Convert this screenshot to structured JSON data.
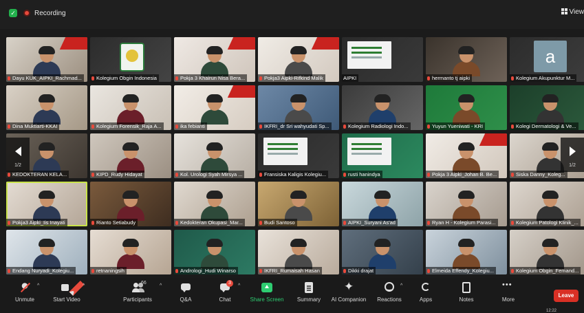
{
  "topbar": {
    "recording_label": "Recording",
    "view_label": "View"
  },
  "pager": {
    "left": "1/2",
    "right": "1/2"
  },
  "tiles": [
    {
      "name": "Dayu KUK_AIPKI_Rachmad...",
      "a": "#d8d2c8",
      "b": "#9c8f80"
    },
    {
      "name": "Kolegium Obgin Indonesia",
      "a": "#2c2c2c",
      "b": "#444"
    },
    {
      "name": "Pokja 3 Khairun Nisa Bera...",
      "a": "#efe9e4",
      "b": "#cfc5bb"
    },
    {
      "name": "Pokja3 Aipki-Rifkind Malik",
      "a": "#f0ece6",
      "b": "#d3c9bf"
    },
    {
      "name": "AIPKI",
      "a": "#2a2a2a",
      "b": "#3a3a3a"
    },
    {
      "name": "hermanto tj aipki",
      "a": "#3a332c",
      "b": "#6e6258"
    },
    {
      "name": "Kolegium Akupunktur M...",
      "a": "#2c2c2c",
      "b": "#3d3d3d"
    },
    {
      "name": "Dina Muktiarti-KKAI",
      "a": "#d9d1c6",
      "b": "#a59886"
    },
    {
      "name": "Kolegium Forensik_Raja A...",
      "a": "#eae6e0",
      "b": "#c8bfb4"
    },
    {
      "name": "ika febianti",
      "a": "#f2ede7",
      "b": "#d6ccc1"
    },
    {
      "name": "IKFRI_dr Sri wahyudati Sp...",
      "a": "#6d88a6",
      "b": "#3f5a78"
    },
    {
      "name": "Kolegium Radiologi Indo...",
      "a": "#3b3b3b",
      "b": "#666"
    },
    {
      "name": "Yuyun Yueniwati - KRI",
      "a": "#1e7a3a",
      "b": "#2f8f4a"
    },
    {
      "name": "Kolegi Dermatologi & Ve...",
      "a": "#1c3f2a",
      "b": "#2c5a3c"
    },
    {
      "name": "KEDOKTERAN KELA...",
      "a": "#6a6258",
      "b": "#3d3630"
    },
    {
      "name": "KIPD_Rudy Hidayat",
      "a": "#cfc7bd",
      "b": "#9b8f82"
    },
    {
      "name": "Kol. Urologi Syah Mirsya ...",
      "a": "#e6e2dc",
      "b": "#b7aea3"
    },
    {
      "name": "Fransiska Kaligis Kolegiu...",
      "a": "#2b2b2b",
      "b": "#3a3a3a"
    },
    {
      "name": "rusti hanindya",
      "a": "#1f6b4a",
      "b": "#2c8a5f"
    },
    {
      "name": "Pokja 3 Aipki_Johan B. Be...",
      "a": "#f1ece6",
      "b": "#d1c7bc"
    },
    {
      "name": "Siska Danny_Koleg...",
      "a": "#dcd6ce",
      "b": "#a89c8e"
    },
    {
      "name": "Pokja3 Aipki_Iis Inayati",
      "a": "#e4dcd3",
      "b": "#b3a596"
    },
    {
      "name": "Rianto Setiabudy",
      "a": "#7a5a3c",
      "b": "#3e2d20"
    },
    {
      "name": "Kedokteran Okupasi_Mar...",
      "a": "#e0d9d0",
      "b": "#ad9f8f"
    },
    {
      "name": "Budi Santoso",
      "a": "#c8a870",
      "b": "#7d6236"
    },
    {
      "name": "AIPKI_Suryani As'ad",
      "a": "#c9d8dc",
      "b": "#8ea3a8"
    },
    {
      "name": "Ryan H - Kolegium Parasi...",
      "a": "#d9d3cc",
      "b": "#a69b8f"
    },
    {
      "name": "Kolegium Patologi Klinik_...",
      "a": "#ddd6ce",
      "b": "#aa9d8f"
    },
    {
      "name": "Endang Nuryadi_Kolegiu...",
      "a": "#dfe5ea",
      "b": "#9fb0bd"
    },
    {
      "name": "retnaningsih",
      "a": "#e6ddd3",
      "b": "#b6a593"
    },
    {
      "name": "Andrologi_Hudi Winarso",
      "a": "#1f5a4a",
      "b": "#2d7a63"
    },
    {
      "name": "IKFRI_Rumaisah Hasan",
      "a": "#e9e2da",
      "b": "#b9ab9c"
    },
    {
      "name": "Dikki drajat",
      "a": "#5f6e7c",
      "b": "#34404b"
    },
    {
      "name": "Elmeida Effendy_Kolegiu...",
      "a": "#c9d3db",
      "b": "#7f909e"
    },
    {
      "name": "Kolegium Obgin_Femand...",
      "a": "#d6d0c8",
      "b": "#9f9386"
    }
  ],
  "toolbar": {
    "unmute": "Unmute",
    "start_video": "Start Video",
    "participants": "Participants",
    "participants_count": "66",
    "qa": "Q&A",
    "chat": "Chat",
    "chat_badge": "3",
    "share": "Share Screen",
    "summary": "Summary",
    "ai": "AI Companion",
    "reactions": "Reactions",
    "apps": "Apps",
    "notes": "Notes",
    "more": "More",
    "leave": "Leave"
  },
  "clock": "12:22"
}
